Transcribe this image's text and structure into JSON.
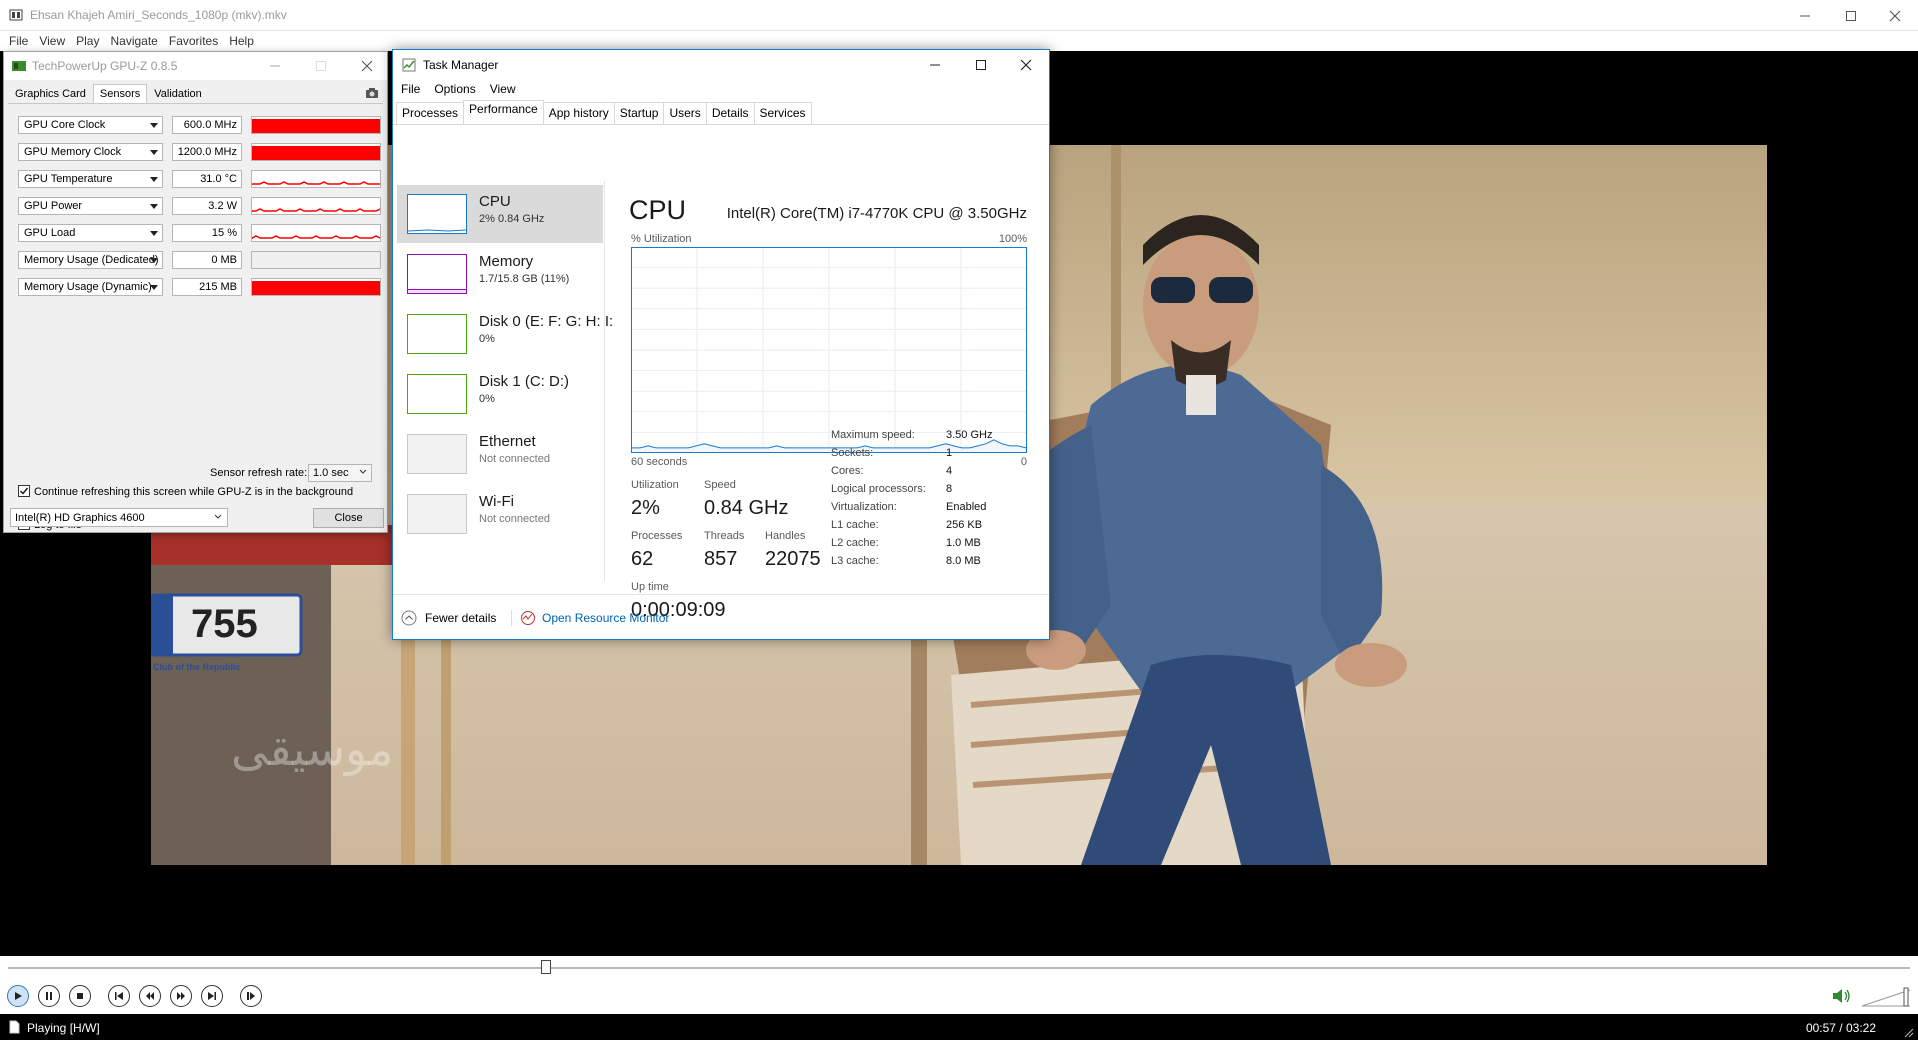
{
  "player": {
    "title": "Ehsan Khajeh Amiri_Seconds_1080p (mkv).mkv",
    "menu": [
      "File",
      "View",
      "Play",
      "Navigate",
      "Favorites",
      "Help"
    ],
    "status": "Playing [H/W]",
    "time": "00:57 / 03:22",
    "seek_fraction": 0.283,
    "plate_text": "755",
    "plate_sub": "Club of the Republic"
  },
  "gpuz": {
    "title": "TechPowerUp GPU-Z 0.8.5",
    "tabs": [
      "Graphics Card",
      "Sensors",
      "Validation"
    ],
    "active_tab": "Sensors",
    "sensors": [
      {
        "label": "GPU Core Clock",
        "value": "600.0 MHz",
        "fill": "full"
      },
      {
        "label": "GPU Memory Clock",
        "value": "1200.0 MHz",
        "fill": "full"
      },
      {
        "label": "GPU Temperature",
        "value": "31.0 °C",
        "fill": "low"
      },
      {
        "label": "GPU Power",
        "value": "3.2 W",
        "fill": "low"
      },
      {
        "label": "GPU Load",
        "value": "15 %",
        "fill": "low"
      },
      {
        "label": "Memory Usage (Dedicated)",
        "value": "0 MB",
        "fill": "none"
      },
      {
        "label": "Memory Usage (Dynamic)",
        "value": "215 MB",
        "fill": "full"
      }
    ],
    "log_to_file": "Log to file",
    "refresh_label": "Sensor refresh rate:",
    "refresh_value": "1.0 sec",
    "continue_label": "Continue refreshing this screen while GPU-Z is in the background",
    "gpu_select": "Intel(R) HD Graphics 4600",
    "close_label": "Close",
    "bar_color": "#ff0000"
  },
  "taskmgr": {
    "title": "Task Manager",
    "menu": [
      "File",
      "Options",
      "View"
    ],
    "tabs": [
      "Processes",
      "Performance",
      "App history",
      "Startup",
      "Users",
      "Details",
      "Services"
    ],
    "active_tab": "Performance",
    "resources": [
      {
        "name": "CPU",
        "sub": "2% 0.84 GHz",
        "color": "#1979ca",
        "selected": true
      },
      {
        "name": "Memory",
        "sub": "1.7/15.8 GB (11%)",
        "color": "#8b12ae",
        "selected": false
      },
      {
        "name": "Disk 0 (E: F: G: H: I:",
        "sub": "0%",
        "color": "#4da60c",
        "selected": false
      },
      {
        "name": "Disk 1 (C: D:)",
        "sub": "0%",
        "color": "#4da60c",
        "selected": false
      },
      {
        "name": "Ethernet",
        "sub": "Not connected",
        "color": "#c8c8c8",
        "selected": false
      },
      {
        "name": "Wi-Fi",
        "sub": "Not connected",
        "color": "#c8c8c8",
        "selected": false
      }
    ],
    "cpu": {
      "heading": "CPU",
      "model": "Intel(R) Core(TM) i7-4770K CPU @ 3.50GHz",
      "util_label": "% Utilization",
      "max_label": "100%",
      "time_label": "60 seconds",
      "zero_label": "0",
      "utilization_label": "Utilization",
      "utilization": "2%",
      "speed_label": "Speed",
      "speed": "0.84 GHz",
      "processes_label": "Processes",
      "processes": "62",
      "threads_label": "Threads",
      "threads": "857",
      "handles_label": "Handles",
      "handles": "22075",
      "uptime_label": "Up time",
      "uptime": "0:00:09:09",
      "specs": [
        {
          "k": "Maximum speed:",
          "v": "3.50 GHz"
        },
        {
          "k": "Sockets:",
          "v": "1"
        },
        {
          "k": "Cores:",
          "v": "4"
        },
        {
          "k": "Logical processors:",
          "v": "8"
        },
        {
          "k": "Virtualization:",
          "v": "Enabled"
        },
        {
          "k": "L1 cache:",
          "v": "256 KB"
        },
        {
          "k": "L2 cache:",
          "v": "1.0 MB"
        },
        {
          "k": "L3 cache:",
          "v": "8.0 MB"
        }
      ],
      "graph_color": "#1979ca",
      "history_percent": [
        2,
        2,
        3,
        2,
        2,
        2,
        2,
        2,
        3,
        4,
        3,
        2,
        2,
        2,
        2,
        2,
        2,
        2,
        3,
        2,
        2,
        2,
        2,
        2,
        2,
        2,
        2,
        2,
        2,
        3,
        2,
        2,
        2,
        2,
        2,
        2,
        2,
        2,
        3,
        4,
        3,
        2,
        2,
        3,
        4,
        6,
        4,
        3,
        3,
        2
      ]
    },
    "fewer_details": "Fewer details",
    "open_resmon": "Open Resource Monitor"
  }
}
